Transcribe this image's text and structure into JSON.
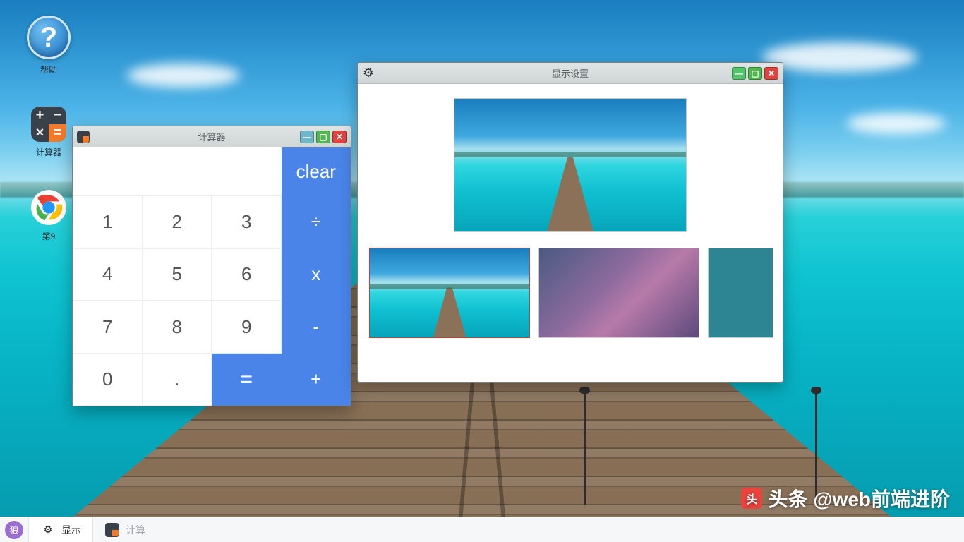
{
  "desktop": {
    "icons": {
      "help": {
        "label": "帮助"
      },
      "calc": {
        "label": "计算器"
      },
      "chrome": {
        "label": "第9"
      }
    }
  },
  "calcWindow": {
    "title": "计算器",
    "keys": {
      "clear": "clear",
      "k1": "1",
      "k2": "2",
      "k3": "3",
      "k4": "4",
      "k5": "5",
      "k6": "6",
      "k7": "7",
      "k8": "8",
      "k9": "9",
      "k0": "0",
      "dot": ".",
      "eq": "=",
      "div": "÷",
      "mul": "x",
      "sub": "-",
      "add": "+"
    }
  },
  "displayWindow": {
    "title": "显示设置",
    "thumbs": [
      "beach",
      "gradient",
      "teal"
    ],
    "selected": 0
  },
  "taskbar": {
    "start": "狼",
    "items": {
      "display": "显示",
      "calc": "计算"
    }
  },
  "watermark": {
    "logo": "头",
    "text": "头条 @web前端进阶"
  },
  "colors": {
    "accent": "#4a84e8",
    "close": "#e0443e",
    "min": "#6fb7c9",
    "max": "#51b84f"
  }
}
